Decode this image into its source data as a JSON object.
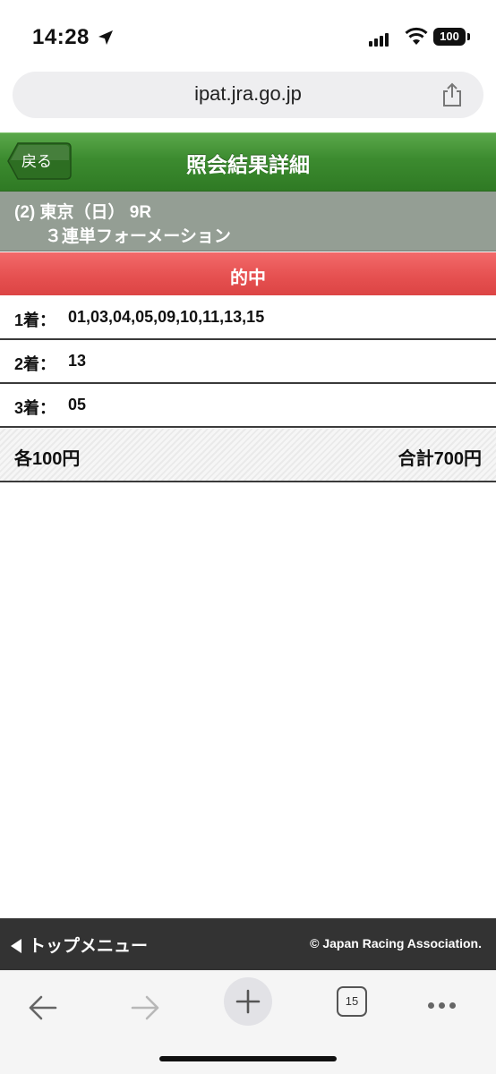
{
  "status_bar": {
    "time": "14:28",
    "battery": "100"
  },
  "browser": {
    "url": "ipat.jra.go.jp",
    "tab_count": "15"
  },
  "header": {
    "back_label": "戻る",
    "title": "照会結果詳細"
  },
  "race": {
    "line1": "(2) 東京（日） 9R",
    "line2": "３連単フォーメーション"
  },
  "result": {
    "status": "的中"
  },
  "positions": [
    {
      "label": "1着：",
      "value": "01,03,04,05,09,10,11,13,15"
    },
    {
      "label": "2着：",
      "value": "13"
    },
    {
      "label": "3着：",
      "value": "05"
    }
  ],
  "summary": {
    "unit_price": "各100円",
    "total": "合計700円"
  },
  "footer": {
    "top_menu": "トップメニュー",
    "copyright": "© Japan Racing Association."
  },
  "colors": {
    "header_green": "#3c8b2f",
    "hit_red": "#e65151",
    "race_gray": "#949e94",
    "footer_dark": "#333333"
  },
  "icons": [
    "location-arrow-icon",
    "signal-icon",
    "wifi-icon",
    "battery-icon",
    "share-icon",
    "back-arrow-icon",
    "forward-arrow-icon",
    "plus-icon",
    "tabs-icon",
    "more-icon"
  ]
}
